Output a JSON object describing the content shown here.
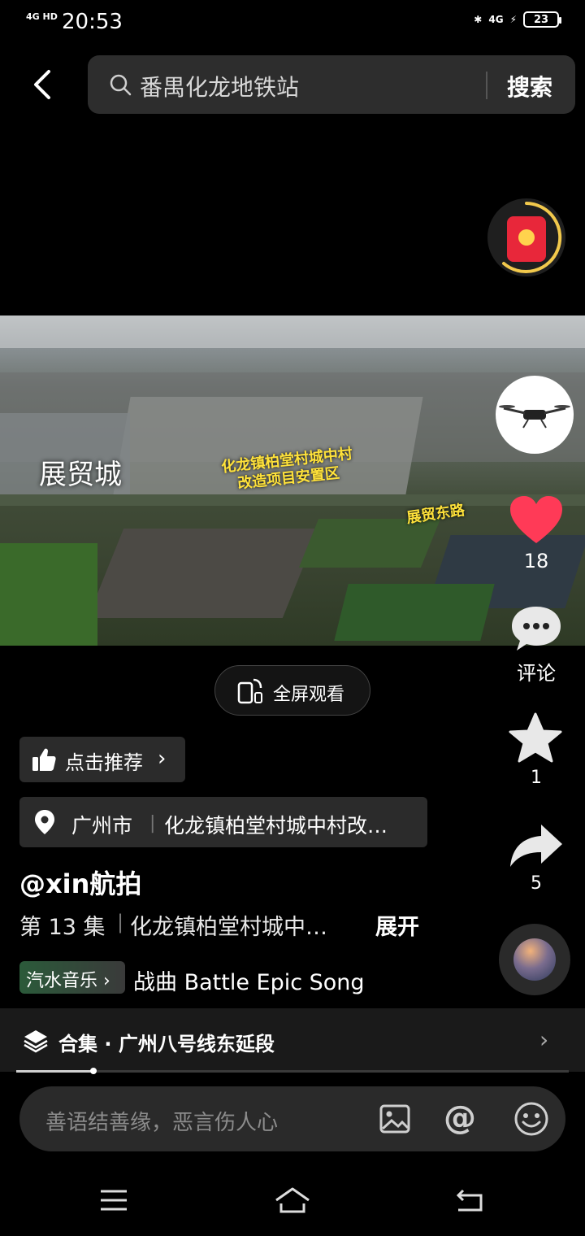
{
  "status_bar": {
    "signal": "4G HD",
    "time": "20:53",
    "network": "4G",
    "battery": "23"
  },
  "search": {
    "query": "番禺化龙地铁站",
    "button": "搜索"
  },
  "video": {
    "overlay_labels": {
      "place_big": "展贸城",
      "project_line1": "化龙镇柏堂村城中村",
      "project_line2": "改造项目安置区",
      "road": "展贸东路"
    },
    "fullscreen_label": "全屏观看"
  },
  "actions": {
    "likes": "18",
    "comment_label": "评论",
    "favorites": "1",
    "shares": "5"
  },
  "recommend": {
    "label": "点击推荐"
  },
  "location": {
    "city": "广州市",
    "place": "化龙镇柏堂村城中村改…"
  },
  "post": {
    "author": "@xin航拍",
    "episode": "第 13 集",
    "description": "化龙镇柏堂村城中…",
    "expand": "展开"
  },
  "music": {
    "tag": "汽水音乐",
    "title": "战曲 Battle Epic Song"
  },
  "collection": {
    "label": "合集 · 广州八号线东延段"
  },
  "progress": {
    "fraction": 0.14
  },
  "comment_input": {
    "placeholder": "善语结善缘，恶言伤人心"
  },
  "colors": {
    "like": "#ff3a57",
    "redpacket": "#e8273a",
    "redpacket_ring": "#f2c94c",
    "label_yellow": "#ffe23a"
  },
  "icons": [
    "back-icon",
    "search-icon",
    "red-packet-icon",
    "heart-icon",
    "comment-icon",
    "star-icon",
    "share-icon",
    "thumbs-up-icon",
    "location-pin-icon",
    "layers-icon",
    "image-icon",
    "at-icon",
    "emoji-icon",
    "menu-icon",
    "home-icon",
    "back-nav-icon"
  ]
}
